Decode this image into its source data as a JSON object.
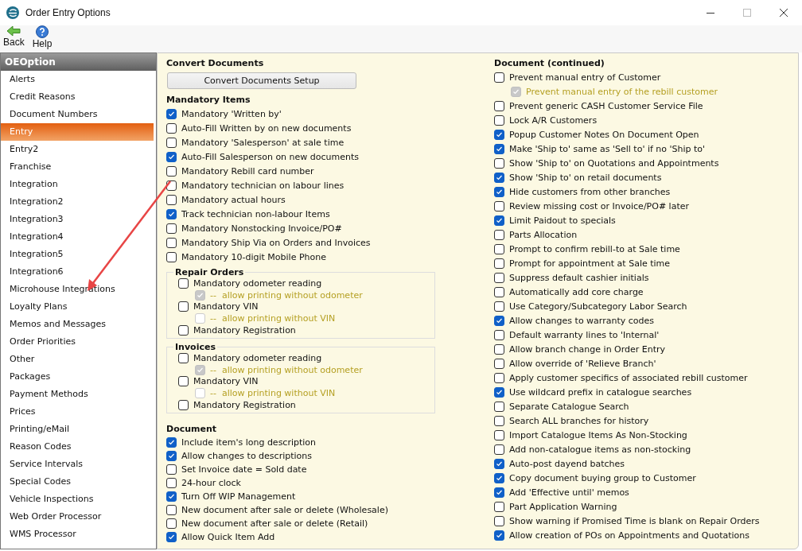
{
  "window": {
    "title": "Order Entry Options"
  },
  "toolbar": [
    {
      "kind": "back",
      "label": "Back"
    },
    {
      "kind": "help",
      "label": "Help"
    }
  ],
  "sidebar": {
    "header": "OEOption",
    "items": [
      {
        "label": "Alerts",
        "selected": false
      },
      {
        "label": "Credit Reasons",
        "selected": false
      },
      {
        "label": "Document Numbers",
        "selected": false
      },
      {
        "label": "Entry",
        "selected": true
      },
      {
        "label": "Entry2",
        "selected": false
      },
      {
        "label": "Franchise",
        "selected": false
      },
      {
        "label": "Integration",
        "selected": false
      },
      {
        "label": "Integration2",
        "selected": false
      },
      {
        "label": "Integration3",
        "selected": false
      },
      {
        "label": "Integration4",
        "selected": false
      },
      {
        "label": "Integration5",
        "selected": false
      },
      {
        "label": "Integration6",
        "selected": false
      },
      {
        "label": "Microhouse Integrations",
        "selected": false
      },
      {
        "label": "Loyalty Plans",
        "selected": false
      },
      {
        "label": "Memos and Messages",
        "selected": false
      },
      {
        "label": "Order Priorities",
        "selected": false
      },
      {
        "label": "Other",
        "selected": false
      },
      {
        "label": "Packages",
        "selected": false
      },
      {
        "label": "Payment Methods",
        "selected": false
      },
      {
        "label": "Prices",
        "selected": false
      },
      {
        "label": "Printing/eMail",
        "selected": false
      },
      {
        "label": "Reason Codes",
        "selected": false
      },
      {
        "label": "Service Intervals",
        "selected": false
      },
      {
        "label": "Special Codes",
        "selected": false
      },
      {
        "label": "Vehicle Inspections",
        "selected": false
      },
      {
        "label": "Web Order Processor",
        "selected": false
      },
      {
        "label": "WMS Processor",
        "selected": false
      }
    ]
  },
  "convert_documents": {
    "heading": "Convert Documents",
    "button": "Convert Documents Setup"
  },
  "mandatory_items": {
    "heading": "Mandatory Items",
    "options": [
      {
        "label": "Mandatory 'Written by'",
        "checked": true,
        "disabled": false
      },
      {
        "label": "Auto-Fill Written by on new documents",
        "checked": false,
        "disabled": false
      },
      {
        "label": "Mandatory 'Salesperson' at sale time",
        "checked": false,
        "disabled": false
      },
      {
        "label": "Auto-Fill Salesperson on new documents",
        "checked": true,
        "disabled": false
      },
      {
        "label": "Mandatory Rebill card number",
        "checked": false,
        "disabled": false
      },
      {
        "label": "Mandatory technician on labour lines",
        "checked": false,
        "disabled": false
      },
      {
        "label": "Mandatory actual hours",
        "checked": false,
        "disabled": false
      },
      {
        "label": "Track technician non-labour Items",
        "checked": true,
        "disabled": false
      },
      {
        "label": "Mandatory Nonstocking Invoice/PO#",
        "checked": false,
        "disabled": false
      },
      {
        "label": "Mandatory Ship Via on Orders and Invoices",
        "checked": false,
        "disabled": false
      },
      {
        "label": "Mandatory 10-digit Mobile Phone",
        "checked": false,
        "disabled": false
      }
    ]
  },
  "repair_orders": {
    "legend": "Repair Orders",
    "options": [
      {
        "label": "Mandatory odometer reading",
        "checked": false,
        "disabled": false,
        "children": [
          {
            "label": "--  allow printing without odometer",
            "checked": true,
            "disabled": true
          }
        ]
      },
      {
        "label": "Mandatory VIN",
        "checked": false,
        "disabled": false,
        "children": [
          {
            "label": "--  allow printing without VIN",
            "checked": false,
            "disabled": true
          }
        ]
      },
      {
        "label": "Mandatory Registration",
        "checked": false,
        "disabled": false
      }
    ]
  },
  "invoices": {
    "legend": "Invoices",
    "options": [
      {
        "label": "Mandatory odometer reading",
        "checked": false,
        "disabled": false,
        "children": [
          {
            "label": "--  allow printing without odometer",
            "checked": true,
            "disabled": true
          }
        ]
      },
      {
        "label": "Mandatory VIN",
        "checked": false,
        "disabled": false,
        "children": [
          {
            "label": "--  allow printing without VIN",
            "checked": false,
            "disabled": true
          }
        ]
      },
      {
        "label": "Mandatory Registration",
        "checked": false,
        "disabled": false
      }
    ]
  },
  "document": {
    "heading": "Document",
    "options": [
      {
        "label": "Include item's long description",
        "checked": true,
        "disabled": false
      },
      {
        "label": "Allow changes to descriptions",
        "checked": true,
        "disabled": false
      },
      {
        "label": "Set Invoice date = Sold date",
        "checked": false,
        "disabled": false
      },
      {
        "label": "24-hour clock",
        "checked": false,
        "disabled": false
      },
      {
        "label": "Turn Off WIP Management",
        "checked": true,
        "disabled": false
      },
      {
        "label": "New document after sale or delete (Wholesale)",
        "checked": false,
        "disabled": false
      },
      {
        "label": "New document after sale or delete (Retail)",
        "checked": false,
        "disabled": false
      },
      {
        "label": "Allow Quick Item Add",
        "checked": true,
        "disabled": false
      }
    ]
  },
  "document_continued": {
    "heading": "Document (continued)",
    "options": [
      {
        "label": "Prevent manual entry of Customer",
        "checked": false,
        "disabled": false,
        "children": [
          {
            "label": "Prevent manual entry of the rebill customer",
            "checked": true,
            "disabled": true
          }
        ]
      },
      {
        "label": "Prevent generic CASH Customer Service File",
        "checked": false,
        "disabled": false
      },
      {
        "label": "Lock A/R Customers",
        "checked": false,
        "disabled": false
      },
      {
        "label": "Popup Customer Notes On Document Open",
        "checked": true,
        "disabled": false
      },
      {
        "label": "Make 'Ship to' same as 'Sell to' if no 'Ship to'",
        "checked": true,
        "disabled": false
      },
      {
        "label": "Show 'Ship to' on Quotations and Appointments",
        "checked": false,
        "disabled": false
      },
      {
        "label": "Show 'Ship to' on retail documents",
        "checked": true,
        "disabled": false
      },
      {
        "label": "Hide customers from other branches",
        "checked": true,
        "disabled": false
      },
      {
        "label": "Review missing cost or Invoice/PO# later",
        "checked": false,
        "disabled": false
      },
      {
        "label": "Limit Paidout to specials",
        "checked": true,
        "disabled": false
      },
      {
        "label": "Parts Allocation",
        "checked": false,
        "disabled": false
      },
      {
        "label": "Prompt to confirm rebill-to at Sale time",
        "checked": false,
        "disabled": false
      },
      {
        "label": "Prompt for appointment at Sale time",
        "checked": false,
        "disabled": false
      },
      {
        "label": "Suppress default cashier initials",
        "checked": false,
        "disabled": false
      },
      {
        "label": "Automatically add core charge",
        "checked": false,
        "disabled": false
      },
      {
        "label": "Use Category/Subcategory Labor Search",
        "checked": false,
        "disabled": false
      },
      {
        "label": "Allow changes to warranty codes",
        "checked": true,
        "disabled": false
      },
      {
        "label": "Default warranty lines to 'Internal'",
        "checked": false,
        "disabled": false
      },
      {
        "label": "Allow branch change in Order Entry",
        "checked": false,
        "disabled": false
      },
      {
        "label": "Allow override of 'Relieve Branch'",
        "checked": false,
        "disabled": false
      },
      {
        "label": "Apply customer specifics of associated rebill customer",
        "checked": false,
        "disabled": false
      },
      {
        "label": "Use wildcard prefix in catalogue searches",
        "checked": true,
        "disabled": false
      },
      {
        "label": "Separate Catalogue Search",
        "checked": false,
        "disabled": false
      },
      {
        "label": "Search ALL branches for history",
        "checked": false,
        "disabled": false
      },
      {
        "label": "Import Catalogue Items As Non-Stocking",
        "checked": false,
        "disabled": false
      },
      {
        "label": "Add non-catalogue items as non-stocking",
        "checked": false,
        "disabled": false
      },
      {
        "label": "Auto-post dayend batches",
        "checked": true,
        "disabled": false
      },
      {
        "label": "Copy document buying group to Customer",
        "checked": true,
        "disabled": false
      },
      {
        "label": "Add 'Effective until' memos",
        "checked": true,
        "disabled": false
      },
      {
        "label": "Part Application Warning",
        "checked": false,
        "disabled": false
      },
      {
        "label": "Show warning if Promised Time is blank on Repair Orders",
        "checked": false,
        "disabled": false
      },
      {
        "label": "Allow creation of POs on Appointments and Quotations",
        "checked": true,
        "disabled": false
      }
    ]
  }
}
